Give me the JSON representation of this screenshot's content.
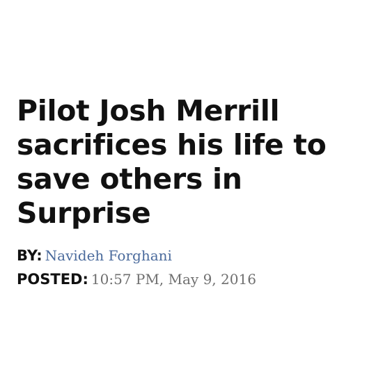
{
  "article": {
    "headline": "Pilot Josh Merrill sacrifices his life to save others in Surprise",
    "byline_label": "BY:",
    "author": "Navideh Forghani",
    "posted_label": "POSTED:",
    "posted_datetime": "10:57 PM, May 9, 2016"
  },
  "colors": {
    "headline": "#111111",
    "author_link": "#4a6a9c",
    "date_text": "#6f6f6f",
    "background": "#ffffff"
  }
}
